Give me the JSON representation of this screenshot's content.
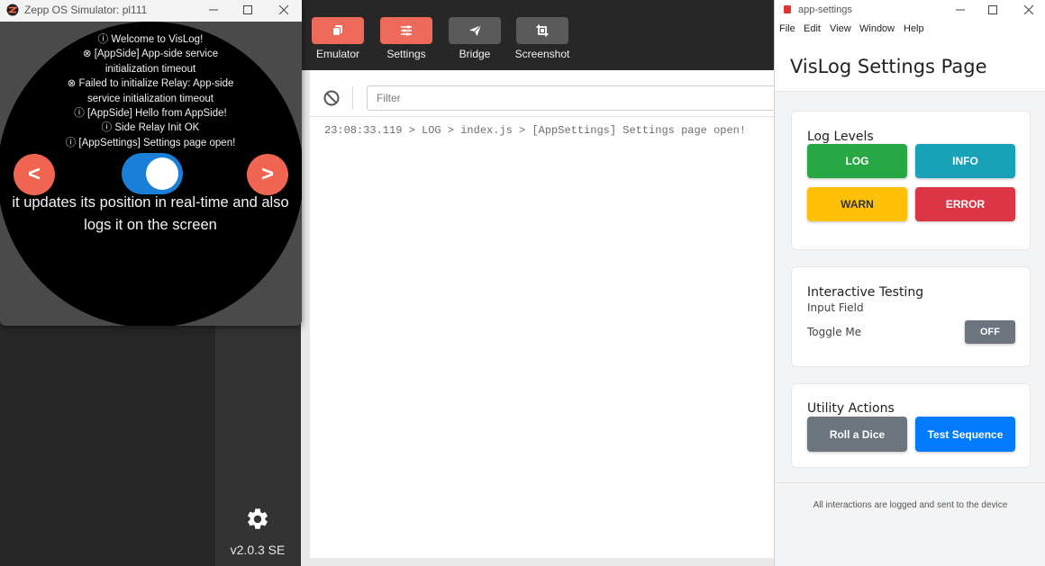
{
  "simulator": {
    "title": "Zepp OS Simulator: pl111",
    "log_lines": [
      "ⓘ Welcome to VisLog!",
      "⊗ [AppSide] App-side service",
      "initialization timeout",
      "⊗ Failed to initialize Relay: App-side",
      "service initialization timeout",
      "ⓘ [AppSide] Hello from AppSide!",
      "ⓘ Side Relay Init OK",
      "ⓘ [AppSettings] Settings page open!"
    ],
    "prev_label": "<",
    "next_label": ">",
    "caption": "it updates its position in real-time and also logs it on the screen",
    "toggle_on": true
  },
  "toolbar": {
    "buttons": [
      {
        "label": "Emulator",
        "icon": "emulator-icon"
      },
      {
        "label": "Settings",
        "icon": "sliders-icon"
      },
      {
        "label": "Bridge",
        "icon": "send-icon"
      },
      {
        "label": "Screenshot",
        "icon": "crop-icon"
      }
    ]
  },
  "rail": {
    "version": "v2.0.3 SE",
    "icon": "gear-icon"
  },
  "log_panel": {
    "filter_placeholder": "Filter",
    "entries": [
      "23:08:33.119 > LOG > index.js > [AppSettings] Settings page open!"
    ]
  },
  "settings_window": {
    "title": "app-settings",
    "menu": [
      "File",
      "Edit",
      "View",
      "Window",
      "Help"
    ],
    "heading": "VisLog Settings Page",
    "log_levels": {
      "title": "Log Levels",
      "buttons": [
        {
          "label": "LOG",
          "color": "#28a745"
        },
        {
          "label": "INFO",
          "color": "#17a2b8"
        },
        {
          "label": "WARN",
          "color": "#ffc107"
        },
        {
          "label": "ERROR",
          "color": "#dc3545"
        }
      ]
    },
    "interactive": {
      "title": "Interactive Testing",
      "input_label": "Input Field",
      "toggle_label": "Toggle Me",
      "toggle_state": "OFF"
    },
    "utility": {
      "title": "Utility Actions",
      "roll_label": "Roll a Dice",
      "sequence_label": "Test Sequence"
    },
    "footer": "All interactions are logged and sent to the device"
  },
  "colors": {
    "accent": "#ed6a5a",
    "toggle_blue": "#1a7fd6",
    "primary_blue": "#007bff",
    "secondary_gray": "#6c757d"
  }
}
